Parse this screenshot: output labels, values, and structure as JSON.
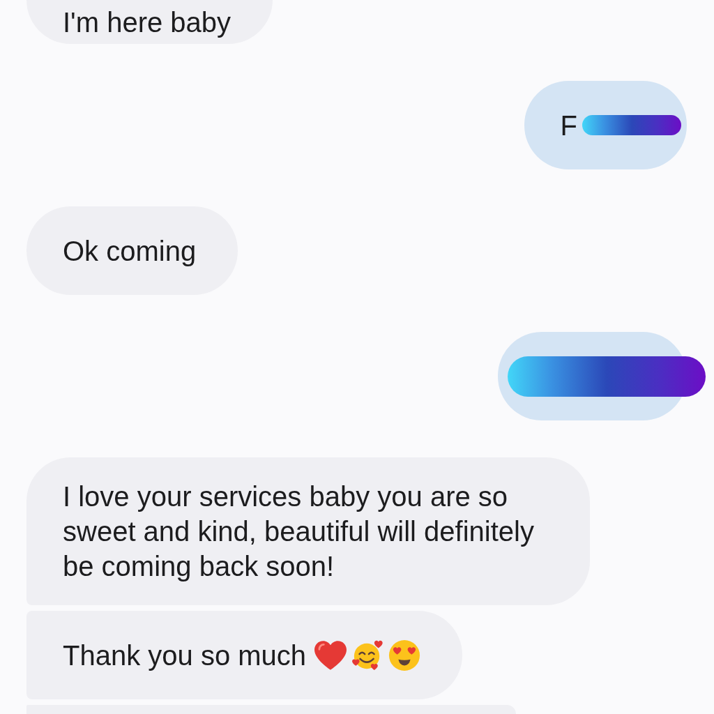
{
  "conversation": {
    "messages": [
      {
        "kind": "received",
        "text": "I'm here baby",
        "redacted": false
      },
      {
        "kind": "sent",
        "text": "F",
        "redacted": true
      },
      {
        "kind": "received",
        "text": "Ok coming",
        "redacted": false
      },
      {
        "kind": "sent",
        "redacted": true
      },
      {
        "kind": "received",
        "text": "I love your services baby you are so sweet and kind, beautiful will definitely be coming back soon!",
        "redacted": false
      },
      {
        "kind": "received",
        "text": "Thank you so much",
        "redacted": false,
        "emoji": [
          {
            "kind": "heart"
          },
          {
            "kind": "smiling-face-with-hearts"
          },
          {
            "kind": "heart-eyes"
          }
        ]
      },
      {
        "kind": "received",
        "redacted": false
      }
    ]
  }
}
